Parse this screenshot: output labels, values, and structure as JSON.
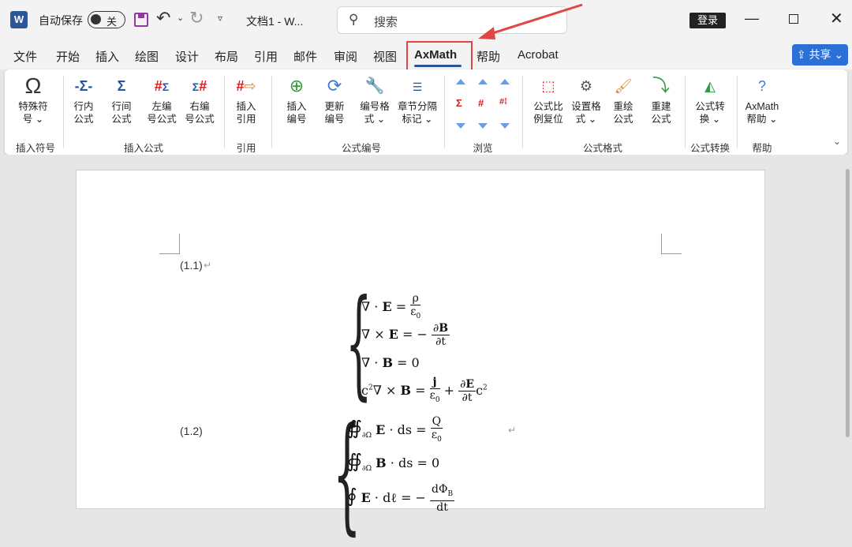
{
  "titlebar": {
    "app_logo": "W",
    "autosave_label": "自动保存",
    "autosave_state": "关",
    "doc_title": "文档1 - W...",
    "search_placeholder": "搜索",
    "login_label": "登录",
    "icons": [
      "save-icon",
      "undo-icon",
      "redo-icon",
      "minimize-icon",
      "maximize-icon",
      "close-icon"
    ]
  },
  "tabs": [
    {
      "label": "文件"
    },
    {
      "label": "开始"
    },
    {
      "label": "插入"
    },
    {
      "label": "绘图"
    },
    {
      "label": "设计"
    },
    {
      "label": "布局"
    },
    {
      "label": "引用"
    },
    {
      "label": "邮件"
    },
    {
      "label": "审阅"
    },
    {
      "label": "视图"
    },
    {
      "label": "AxMath",
      "active": true
    },
    {
      "label": "帮助"
    },
    {
      "label": "Acrobat"
    }
  ],
  "share_label": "共享",
  "ribbon": {
    "groups": {
      "symbols": "插入符号",
      "insert_formula": "插入公式",
      "reference": "引用",
      "numbering": "公式编号",
      "browse": "浏览",
      "format": "公式格式",
      "convert": "公式转换",
      "help": "帮助"
    },
    "buttons": {
      "special_symbol": [
        "特殊符",
        "号 ⌄"
      ],
      "inline_formula": [
        "行内",
        "公式"
      ],
      "display_formula": [
        "行间",
        "公式"
      ],
      "left_numbered": [
        "左编",
        "号公式"
      ],
      "right_numbered": [
        "右编",
        "号公式"
      ],
      "insert_reference": [
        "插入",
        "引用"
      ],
      "insert_number": [
        "插入",
        "编号"
      ],
      "update_number": [
        "更新",
        "编号"
      ],
      "number_format": [
        "编号格",
        "式 ⌄"
      ],
      "chapter_separator": [
        "章节分隔",
        "标记 ⌄"
      ],
      "reset_scale": [
        "公式比",
        "例复位"
      ],
      "set_format": [
        "设置格",
        "式 ⌄"
      ],
      "redraw_formula": [
        "重绘",
        "公式"
      ],
      "rebuild_formula": [
        "重建",
        "公式"
      ],
      "formula_convert": [
        "公式转",
        "换 ⌄"
      ],
      "axmath_help": [
        "AxMath",
        "帮助 ⌄"
      ]
    }
  },
  "document": {
    "eq1_number": "(1.1)",
    "eq2_number": "(1.2)",
    "paragraph_mark": "↵",
    "eq1_lines": [
      "∇ · E = ρ / ε₀",
      "∇ × E = − ∂B / ∂t",
      "∇ · B = 0",
      "c²∇ × B = j / ε₀ + ∂E / ∂t c²"
    ],
    "eq2_lines": [
      "∯∂Ω E · ds = Q / ε₀",
      "∯∂Ω B · ds = 0",
      "∮ E · dℓ = − dΦB / dt"
    ]
  },
  "colors": {
    "accent": "#2b579a",
    "highlight": "#e04646",
    "share": "#2b70d6"
  }
}
